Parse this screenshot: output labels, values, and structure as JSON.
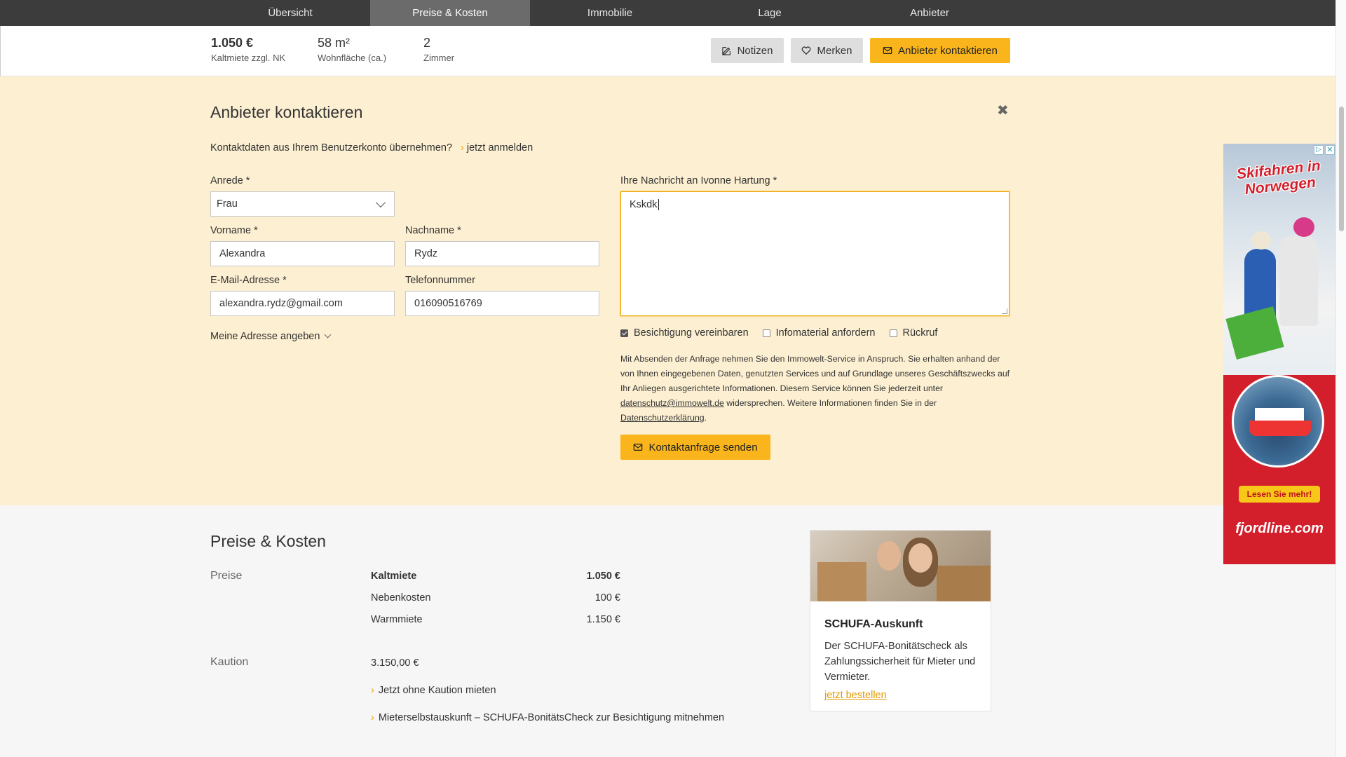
{
  "nav": {
    "tabs": [
      {
        "label": "Übersicht"
      },
      {
        "label": "Preise & Kosten"
      },
      {
        "label": "Immobilie"
      },
      {
        "label": "Lage"
      },
      {
        "label": "Anbieter"
      }
    ],
    "active_tab": "Preise & Kosten"
  },
  "summary": {
    "rent_value": "1.050 €",
    "rent_label": "Kaltmiete zzgl. NK",
    "area_value": "58 m²",
    "area_label": "Wohnfläche (ca.)",
    "rooms_value": "2",
    "rooms_label": "Zimmer",
    "notes_button": "Notizen",
    "save_button": "Merken",
    "contact_button": "Anbieter kontaktieren"
  },
  "contact": {
    "title": "Anbieter kontaktieren",
    "login_prompt": "Kontaktdaten aus Ihrem Benutzerkonto übernehmen?",
    "login_link": "jetzt anmelden",
    "salutation_label": "Anrede *",
    "salutation_value": "Frau",
    "firstname_label": "Vorname *",
    "firstname_value": "Alexandra",
    "lastname_label": "Nachname *",
    "lastname_value": "Rydz",
    "email_label": "E-Mail-Adresse *",
    "email_value": "alexandra.rydz@gmail.com",
    "phone_label": "Telefonnummer",
    "phone_value": "016090516769",
    "address_toggle": "Meine Adresse angeben",
    "message_label": "Ihre Nachricht an Ivonne Hartung *",
    "message_value": "Kskdk",
    "checkboxes": [
      {
        "label": "Besichtigung vereinbaren",
        "checked": true
      },
      {
        "label": "Infomaterial anfordern",
        "checked": false
      },
      {
        "label": "Rückruf",
        "checked": false
      }
    ],
    "legal_text_1": "Mit Absenden der Anfrage nehmen Sie den Immowelt-Service in Anspruch. Sie erhalten anhand der von Ihnen eingegebenen Daten, genutzten Services und auf Grundlage unseres Geschäftszwecks auf Ihr Anliegen ausgerichtete Informationen. Diesem Service können Sie jederzeit unter",
    "legal_email_link": "datenschutz@immowelt.de",
    "legal_text_2": "widersprechen. Weitere Informationen finden Sie in der",
    "legal_privacy_link": "Datenschutzerklärung",
    "legal_text_3": ".",
    "send_button": "Kontaktanfrage senden"
  },
  "prices": {
    "title": "Preise & Kosten",
    "section_prices": "Preise",
    "rows": [
      {
        "name": "Kaltmiete",
        "value": "1.050 €"
      },
      {
        "name": "Nebenkosten",
        "value": "100 €"
      },
      {
        "name": "Warmmiete",
        "value": "1.150 €"
      }
    ],
    "section_deposit": "Kaution",
    "deposit_value": "3.150,00 €",
    "link_1": "Jetzt ohne Kaution mieten",
    "link_2": "Mieterselbstauskunft – SCHUFA-BonitätsCheck zur Besichtigung mitnehmen"
  },
  "schufa_card": {
    "title": "SCHUFA-Auskunft",
    "text": "Der SCHUFA-Bonitätscheck als Zahlungssicherheit für Mieter und Vermieter.",
    "link": "jetzt bestellen"
  },
  "ad": {
    "headline": "Skifahren in Norwegen",
    "cta": "Lesen Sie mehr!",
    "brand": "fjordline.com"
  },
  "colors": {
    "accent": "#f9b51b",
    "nav_bg": "#3c3c3c",
    "panel_bg": "#fdf0d2"
  }
}
